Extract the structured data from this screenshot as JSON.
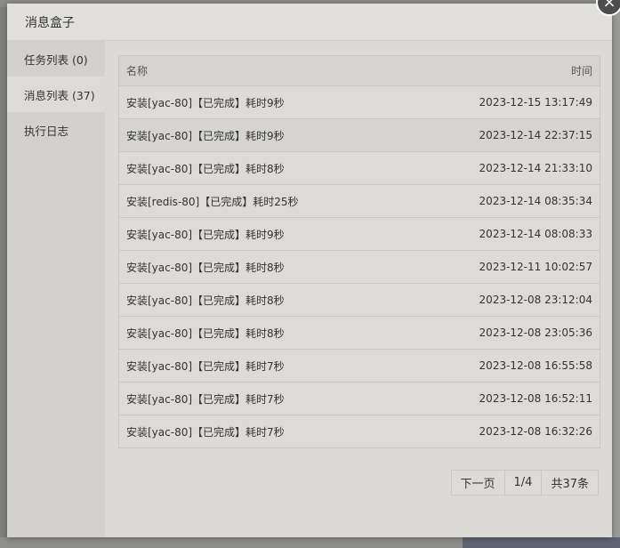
{
  "modal": {
    "title": "消息盒子",
    "close_icon": "×"
  },
  "sidebar": {
    "items": [
      {
        "label": "任务列表 (0)"
      },
      {
        "label": "消息列表 (37)"
      },
      {
        "label": "执行日志"
      }
    ]
  },
  "table": {
    "headers": {
      "name": "名称",
      "time": "时间"
    },
    "rows": [
      {
        "name": "安装[yac-80]【已完成】耗时9秒",
        "time": "2023-12-15 13:17:49"
      },
      {
        "name": "安装[yac-80]【已完成】耗时9秒",
        "time": "2023-12-14 22:37:15"
      },
      {
        "name": "安装[yac-80]【已完成】耗时8秒",
        "time": "2023-12-14 21:33:10"
      },
      {
        "name": "安装[redis-80]【已完成】耗时25秒",
        "time": "2023-12-14 08:35:34"
      },
      {
        "name": "安装[yac-80]【已完成】耗时9秒",
        "time": "2023-12-14 08:08:33"
      },
      {
        "name": "安装[yac-80]【已完成】耗时8秒",
        "time": "2023-12-11 10:02:57"
      },
      {
        "name": "安装[yac-80]【已完成】耗时8秒",
        "time": "2023-12-08 23:12:04"
      },
      {
        "name": "安装[yac-80]【已完成】耗时8秒",
        "time": "2023-12-08 23:05:36"
      },
      {
        "name": "安装[yac-80]【已完成】耗时7秒",
        "time": "2023-12-08 16:55:58"
      },
      {
        "name": "安装[yac-80]【已完成】耗时7秒",
        "time": "2023-12-08 16:52:11"
      },
      {
        "name": "安装[yac-80]【已完成】耗时7秒",
        "time": "2023-12-08 16:32:26"
      }
    ]
  },
  "pager": {
    "next": "下一页",
    "page": "1/4",
    "total": "共37条"
  }
}
